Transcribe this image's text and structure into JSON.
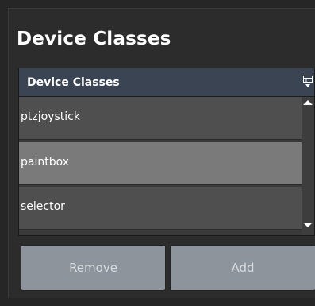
{
  "panel": {
    "title": "Device Classes"
  },
  "table": {
    "header": "Device Classes",
    "rows": [
      {
        "label": "ptzjoystick",
        "selected": false
      },
      {
        "label": "paintbox",
        "selected": true
      },
      {
        "label": "selector",
        "selected": false
      }
    ]
  },
  "buttons": {
    "remove_label": "Remove",
    "add_label": "Add"
  },
  "icons": {
    "header_icon": "column-chooser-icon",
    "scroll_up": "arrow-up-icon",
    "scroll_down": "arrow-down-icon"
  },
  "colors": {
    "background": "#262626",
    "header": "#3b4452",
    "row": "#4f4f4f",
    "row_selected": "#7a7a7a",
    "button": "#8d949c",
    "text": "#ffffff"
  }
}
